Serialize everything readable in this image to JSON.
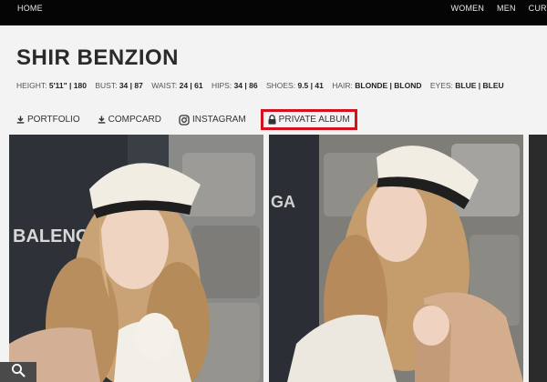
{
  "topnav": {
    "home": "HOME",
    "items": [
      "WOMEN",
      "MEN",
      "CURVE"
    ]
  },
  "model": {
    "name": "SHIR BENZION",
    "stats": [
      {
        "label": "HEIGHT:",
        "value": "5'11\" | 180"
      },
      {
        "label": "BUST:",
        "value": "34 | 87"
      },
      {
        "label": "WAIST:",
        "value": "24 | 61"
      },
      {
        "label": "HIPS:",
        "value": "34 | 86"
      },
      {
        "label": "SHOES:",
        "value": "9.5 | 41"
      },
      {
        "label": "HAIR:",
        "value": "BLONDE | BLOND"
      },
      {
        "label": "EYES:",
        "value": "BLUE | BLEU"
      }
    ]
  },
  "links": {
    "portfolio": "PORTFOLIO",
    "compcard": "COMPCARD",
    "instagram": "INSTAGRAM",
    "private_album": "PRIVATE ALBUM"
  },
  "icons": {
    "portfolio": "download-icon",
    "compcard": "download-icon",
    "instagram": "instagram-icon",
    "private_album": "lock-icon",
    "search": "search-icon"
  },
  "colors": {
    "topbar": "#050505",
    "background": "#f3f3f3",
    "highlight": "#d6101e"
  },
  "photos": {
    "photo_1_sign": "BALENCIAGA",
    "photo_2_sign": "GA"
  }
}
